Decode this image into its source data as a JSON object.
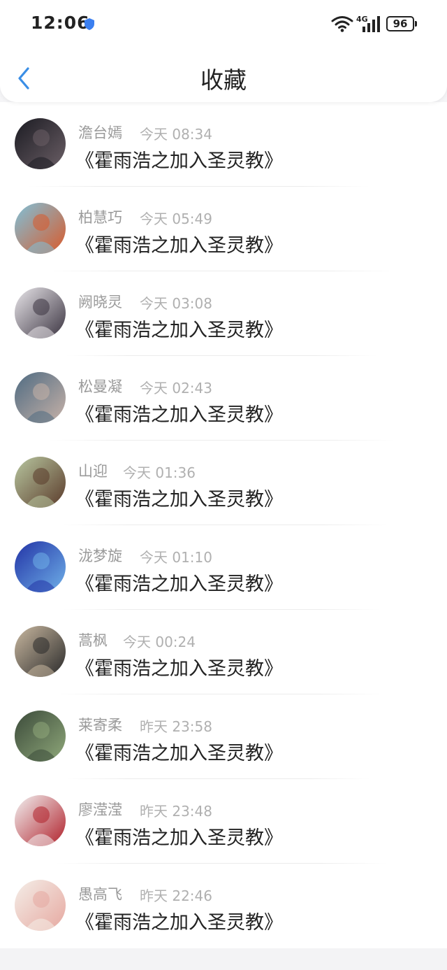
{
  "status_bar": {
    "time": "12:06",
    "network": "4G",
    "battery": "96"
  },
  "nav": {
    "title": "收藏"
  },
  "items": [
    {
      "name": "澹台嫣",
      "time": "今天 08:34",
      "content": "《霍雨浩之加入圣灵教》",
      "avatar_colors": [
        "#1b1b22",
        "#6b5f66"
      ]
    },
    {
      "name": "柏慧巧",
      "time": "今天 05:49",
      "content": "《霍雨浩之加入圣灵教》",
      "avatar_colors": [
        "#7fc1d9",
        "#d95a2b"
      ]
    },
    {
      "name": "阙晓灵",
      "time": "今天 03:08",
      "content": "《霍雨浩之加入圣灵教》",
      "avatar_colors": [
        "#e9e6ea",
        "#3a3340"
      ]
    },
    {
      "name": "松曼凝",
      "time": "今天 02:43",
      "content": "《霍雨浩之加入圣灵教》",
      "avatar_colors": [
        "#4f6b82",
        "#c7b2a8"
      ]
    },
    {
      "name": "山迎",
      "time": "今天 01:36",
      "content": "《霍雨浩之加入圣灵教》",
      "avatar_colors": [
        "#b8c7a0",
        "#5a3a2a"
      ]
    },
    {
      "name": "泷梦旋",
      "time": "今天 01:10",
      "content": "《霍雨浩之加入圣灵教》",
      "avatar_colors": [
        "#2233a6",
        "#6fb0e8"
      ]
    },
    {
      "name": "蒿枫",
      "time": "今天 00:24",
      "content": "《霍雨浩之加入圣灵教》",
      "avatar_colors": [
        "#c9b8a0",
        "#2a2a2a"
      ]
    },
    {
      "name": "莱寄柔",
      "time": "昨天 23:58",
      "content": "《霍雨浩之加入圣灵教》",
      "avatar_colors": [
        "#3b4a3a",
        "#8fa87a"
      ]
    },
    {
      "name": "廖滢滢",
      "time": "昨天 23:48",
      "content": "《霍雨浩之加入圣灵教》",
      "avatar_colors": [
        "#f2f2f2",
        "#b0202a"
      ]
    },
    {
      "name": "愚高飞",
      "time": "昨天 22:46",
      "content": "《霍雨浩之加入圣灵教》",
      "avatar_colors": [
        "#f4eee8",
        "#e6a8a0"
      ]
    }
  ]
}
